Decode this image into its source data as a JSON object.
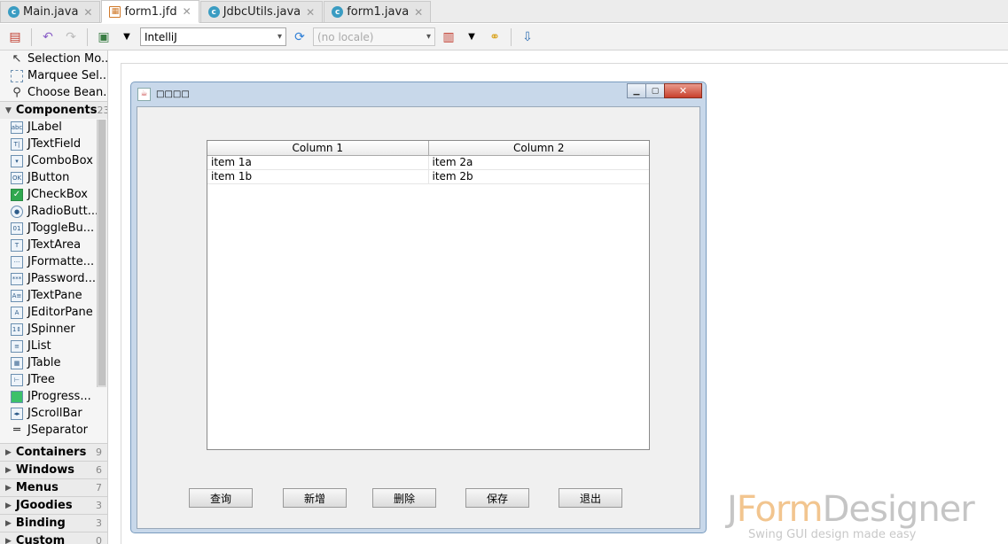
{
  "tabs": [
    {
      "label": "Main.java",
      "icon": "class-icon",
      "active": false
    },
    {
      "label": "form1.jfd",
      "icon": "form-icon",
      "active": true
    },
    {
      "label": "JdbcUtils.java",
      "icon": "class-icon",
      "active": false
    },
    {
      "label": "form1.java",
      "icon": "class-icon",
      "active": false
    }
  ],
  "toolbar": {
    "laf_value": "IntelliJ",
    "locale_value": "(no locale)"
  },
  "palette": {
    "tools": [
      "Selection Mo...",
      "Marquee Sel...",
      "Choose Bean..."
    ],
    "components": {
      "label": "Components",
      "count": "23",
      "items": [
        "JLabel",
        "JTextField",
        "JComboBox",
        "JButton",
        "JCheckBox",
        "JRadioButt...",
        "JToggleBu...",
        "JTextArea",
        "JFormatte...",
        "JPassword...",
        "JTextPane",
        "JEditorPane",
        "JSpinner",
        "JList",
        "JTable",
        "JTree",
        "JProgress...",
        "JScrollBar",
        "JSeparator"
      ]
    },
    "categories": [
      {
        "label": "Containers",
        "count": "9"
      },
      {
        "label": "Windows",
        "count": "6"
      },
      {
        "label": "Menus",
        "count": "7"
      },
      {
        "label": "JGoodies",
        "count": "3"
      },
      {
        "label": "Binding",
        "count": "3"
      },
      {
        "label": "Custom",
        "count": "0"
      }
    ]
  },
  "frame": {
    "title": "□□□□",
    "table": {
      "columns": [
        "Column 1",
        "Column 2"
      ],
      "rows": [
        [
          "item 1a",
          "item 2a"
        ],
        [
          "item 1b",
          "item 2b"
        ]
      ]
    },
    "buttons": [
      "查询",
      "新增",
      "删除",
      "保存",
      "退出"
    ]
  },
  "brand": {
    "j": "J",
    "form": "Form",
    "designer": "Designer",
    "tagline": "Swing GUI design made easy"
  }
}
